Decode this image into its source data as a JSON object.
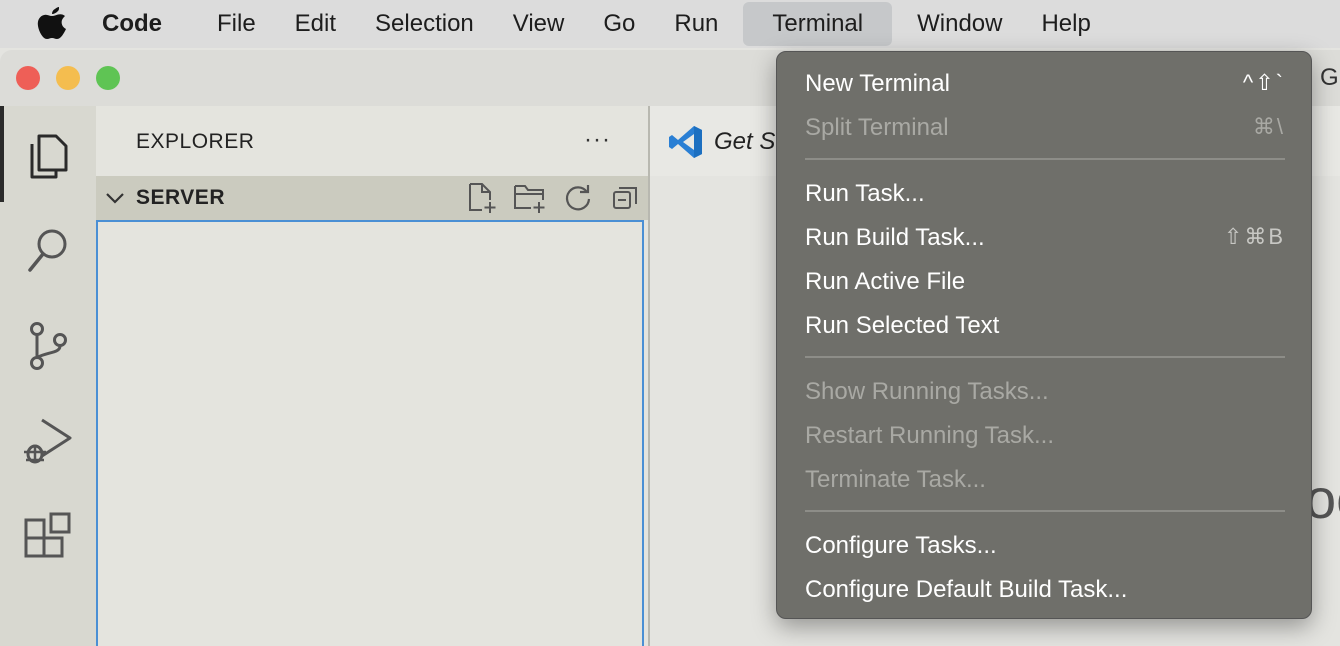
{
  "menubar": {
    "apple_icon": "apple-logo",
    "app_name": "Code",
    "items": [
      "File",
      "Edit",
      "Selection",
      "View",
      "Go",
      "Run",
      "Terminal",
      "Window",
      "Help"
    ],
    "active_item": "Terminal"
  },
  "window": {
    "title_fragment": "G"
  },
  "sidebar": {
    "title": "EXPLORER",
    "more_label": "···",
    "section": "SERVER"
  },
  "editor": {
    "tab_label": "Get S",
    "bg_letters": "oc"
  },
  "terminal_menu": {
    "items": [
      {
        "label": "New Terminal",
        "shortcut": "^⇧`",
        "enabled": true
      },
      {
        "label": "Split Terminal",
        "shortcut": "⌘\\",
        "enabled": false
      },
      {
        "label": "Run Task...",
        "shortcut": "",
        "enabled": true
      },
      {
        "label": "Run Build Task...",
        "shortcut": "⇧⌘B",
        "enabled": true
      },
      {
        "label": "Run Active File",
        "shortcut": "",
        "enabled": true
      },
      {
        "label": "Run Selected Text",
        "shortcut": "",
        "enabled": true
      },
      {
        "label": "Show Running Tasks...",
        "shortcut": "",
        "enabled": false
      },
      {
        "label": "Restart Running Task...",
        "shortcut": "",
        "enabled": false
      },
      {
        "label": "Terminate Task...",
        "shortcut": "",
        "enabled": false
      },
      {
        "label": "Configure Tasks...",
        "shortcut": "",
        "enabled": true
      },
      {
        "label": "Configure Default Build Task...",
        "shortcut": "",
        "enabled": true
      }
    ]
  },
  "colors": {
    "menu_bg": "#6f6f6a",
    "menu_text": "#ffffff",
    "menu_disabled": "#a9a9a4",
    "selection_border": "#4a8fd4",
    "vscode_blue": "#2a7fd4"
  }
}
